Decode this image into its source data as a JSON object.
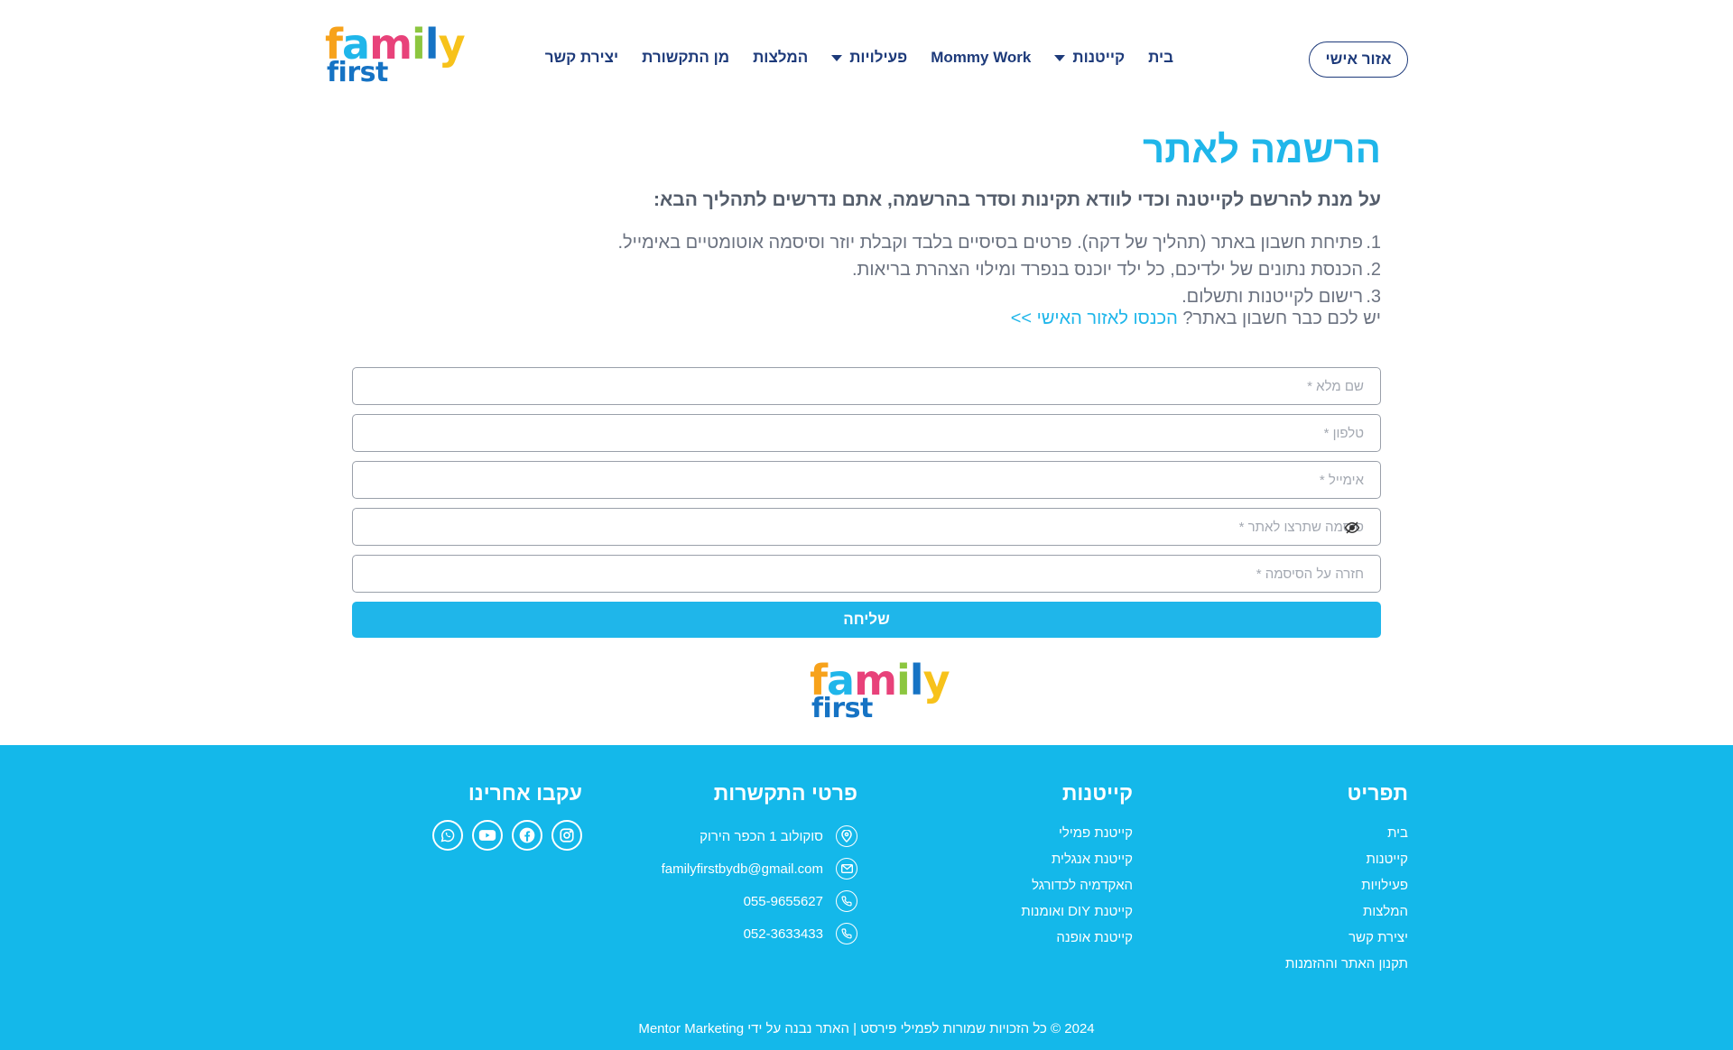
{
  "header": {
    "account_button": "אזור אישי",
    "nav": [
      {
        "label": "בית",
        "dropdown": false
      },
      {
        "label": "קייטנות",
        "dropdown": true
      },
      {
        "label": "Mommy Work",
        "dropdown": false
      },
      {
        "label": "פעילויות",
        "dropdown": true
      },
      {
        "label": "המלצות",
        "dropdown": false
      },
      {
        "label": "מן התקשורת",
        "dropdown": false
      },
      {
        "label": "יצירת קשר",
        "dropdown": false
      }
    ],
    "logo": {
      "top": "family",
      "bottom": "first"
    }
  },
  "main": {
    "title": "הרשמה לאתר",
    "intro": "על מנת להרשם לקייטנה וכדי לוודא תקינות וסדר בהרשמה, אתם נדרשים לתהליך הבא:",
    "steps": [
      {
        "num": "1.",
        "text": "פתיחת חשבון באתר (תהליך של דקה). פרטים בסיסיים בלבד וקבלת יוזר וסיסמה אוטומטיים באימייל."
      },
      {
        "num": "2.",
        "text": "הכנסת נתונים של ילדיכם, כל ילד יוכנס בנפרד ומילוי הצהרת בריאות."
      },
      {
        "num": "3.",
        "text": "רישום לקייטנות ותשלום."
      }
    ],
    "account_question": "יש לכם כבר חשבון באתר?",
    "account_link": "הכנסו לאזור האישי >>",
    "form": {
      "full_name_placeholder": "שם מלא *",
      "phone_placeholder": "טלפון *",
      "email_placeholder": "אימייל *",
      "password_placeholder": "סיסמה שתרצו לאתר *",
      "password_repeat_placeholder": "חזרה על הסיסמה *",
      "submit": "שליחה"
    }
  },
  "footer": {
    "menu_title": "תפריט",
    "menu_links": [
      "בית",
      "קייטנות",
      "פעילויות",
      "המלצות",
      "יצירת קשר",
      "תקנון האתר וההזמנות"
    ],
    "camps_title": "קייטנות",
    "camps_links": [
      "קייטנת פמילי",
      "קייטנת אנגלית",
      "האקדמיה לכדורגל",
      "קייטנת DIY ואומנות",
      "קייטנת אופנה"
    ],
    "contact_title": "פרטי התקשרות",
    "contact": {
      "address": "סוקולוב 1 הכפר הירוק",
      "email": "familyfirstbydb@gmail.com",
      "phone1": "055-9655627",
      "phone2": "052-3633433"
    },
    "follow_title": "עקבו אחרינו",
    "socials": [
      "instagram-icon",
      "facebook-icon",
      "youtube-icon",
      "whatsapp-icon"
    ],
    "copyright": "2024 © כל הזכויות שמורות לפמילי פירסט | האתר נבנה על ידי Mentor Marketing"
  },
  "colors": {
    "accent": "#1fb6ea",
    "navy": "#1d3a7a",
    "footer_bg": "#14b8ea"
  }
}
